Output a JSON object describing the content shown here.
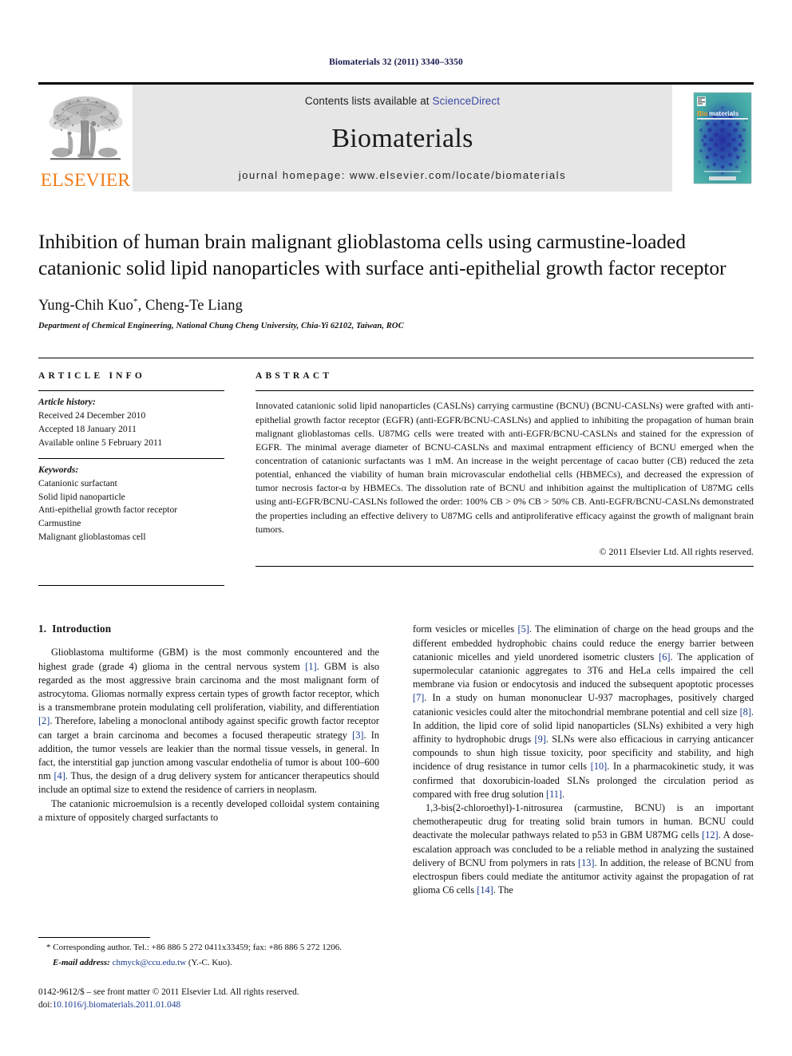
{
  "running_head": "Biomaterials 32 (2011) 3340–3350",
  "masthead": {
    "publisher_name": "ELSEVIER",
    "contents_prefix": "Contents lists available at ",
    "contents_link": "ScienceDirect",
    "journal_title": "Biomaterials",
    "homepage": "journal homepage: www.elsevier.com/locate/biomaterials",
    "cover_title": "Biomaterials",
    "cover_colors": {
      "background": "#3fa8a0",
      "dots": "#2b3fa0",
      "accent": "#f4a020"
    },
    "link_color": "#3b4aa0",
    "brand_color": "#ef7d1a",
    "band_color": "#e6e6e6"
  },
  "article": {
    "title": "Inhibition of human brain malignant glioblastoma cells using carmustine-loaded catanionic solid lipid nanoparticles with surface anti-epithelial growth factor receptor",
    "authors": "Yung-Chih Kuo",
    "authors_marker": "*",
    "authors_rest": ", Cheng-Te Liang",
    "affiliation": "Department of Chemical Engineering, National Chung Cheng University, Chia-Yi 62102, Taiwan, ROC"
  },
  "article_info": {
    "heading": "ARTICLE INFO",
    "history_label": "Article history:",
    "history": [
      "Received 24 December 2010",
      "Accepted 18 January 2011",
      "Available online 5 February 2011"
    ],
    "keywords_label": "Keywords:",
    "keywords": [
      "Catanionic surfactant",
      "Solid lipid nanoparticle",
      "Anti-epithelial growth factor receptor",
      "Carmustine",
      "Malignant glioblastomas cell"
    ]
  },
  "abstract": {
    "heading": "ABSTRACT",
    "text": "Innovated catanionic solid lipid nanoparticles (CASLNs) carrying carmustine (BCNU) (BCNU-CASLNs) were grafted with anti-epithelial growth factor receptor (EGFR) (anti-EGFR/BCNU-CASLNs) and applied to inhibiting the propagation of human brain malignant glioblastomas cells. U87MG cells were treated with anti-EGFR/BCNU-CASLNs and stained for the expression of EGFR. The minimal average diameter of BCNU-CASLNs and maximal entrapment efficiency of BCNU emerged when the concentration of catanionic surfactants was 1 mM. An increase in the weight percentage of cacao butter (CB) reduced the zeta potential, enhanced the viability of human brain microvascular endothelial cells (HBMECs), and decreased the expression of tumor necrosis factor-α by HBMECs. The dissolution rate of BCNU and inhibition against the multiplication of U87MG cells using anti-EGFR/BCNU-CASLNs followed the order: 100% CB > 0% CB > 50% CB. Anti-EGFR/BCNU-CASLNs demonstrated the properties including an effective delivery to U87MG cells and antiproliferative efficacy against the growth of malignant brain tumors.",
    "copyright": "© 2011 Elsevier Ltd. All rights reserved."
  },
  "sections": {
    "intro_number": "1.",
    "intro_title": "Introduction",
    "left_paragraphs": [
      "Glioblastoma multiforme (GBM) is the most commonly encountered and the highest grade (grade 4) glioma in the central nervous system [1]. GBM is also regarded as the most aggressive brain carcinoma and the most malignant form of astrocytoma. Gliomas normally express certain types of growth factor receptor, which is a transmembrane protein modulating cell proliferation, viability, and differentiation [2]. Therefore, labeling a monoclonal antibody against specific growth factor receptor can target a brain carcinoma and becomes a focused therapeutic strategy [3]. In addition, the tumor vessels are leakier than the normal tissue vessels, in general. In fact, the interstitial gap junction among vascular endothelia of tumor is about 100–600 nm [4]. Thus, the design of a drug delivery system for anticancer therapeutics should include an optimal size to extend the residence of carriers in neoplasm.",
      "The catanionic microemulsion is a recently developed colloidal system containing a mixture of oppositely charged surfactants to"
    ],
    "right_paragraphs": [
      "form vesicles or micelles [5]. The elimination of charge on the head groups and the different embedded hydrophobic chains could reduce the energy barrier between catanionic micelles and yield unordered isometric clusters [6]. The application of supermolecular catanionic aggregates to 3T6 and HeLa cells impaired the cell membrane via fusion or endocytosis and induced the subsequent apoptotic processes [7]. In a study on human mononuclear U-937 macrophages, positively charged catanionic vesicles could alter the mitochondrial membrane potential and cell size [8]. In addition, the lipid core of solid lipid nanoparticles (SLNs) exhibited a very high affinity to hydrophobic drugs [9]. SLNs were also efficacious in carrying anticancer compounds to shun high tissue toxicity, poor specificity and stability, and high incidence of drug resistance in tumor cells [10]. In a pharmacokinetic study, it was confirmed that doxorubicin-loaded SLNs prolonged the circulation period as compared with free drug solution [11].",
      "1,3-bis(2-chloroethyl)-1-nitrosurea (carmustine, BCNU) is an important chemotherapeutic drug for treating solid brain tumors in human. BCNU could deactivate the molecular pathways related to p53 in GBM U87MG cells [12]. A dose-escalation approach was concluded to be a reliable method in analyzing the sustained delivery of BCNU from polymers in rats [13]. In addition, the release of BCNU from electrospun fibers could mediate the antitumor activity against the propagation of rat glioma C6 cells [14]. The"
    ]
  },
  "footnotes": {
    "corresponding": "* Corresponding author. Tel.: +86 886 5 272 0411x33459; fax: +86 886 5 272 1206.",
    "email_label": "E-mail address:",
    "email": "chmyck@ccu.edu.tw",
    "email_suffix": "(Y.-C. Kuo).",
    "issn_line": "0142-9612/$ – see front matter © 2011 Elsevier Ltd. All rights reserved.",
    "doi_prefix": "doi:",
    "doi": "10.1016/j.biomaterials.2011.01.048"
  }
}
